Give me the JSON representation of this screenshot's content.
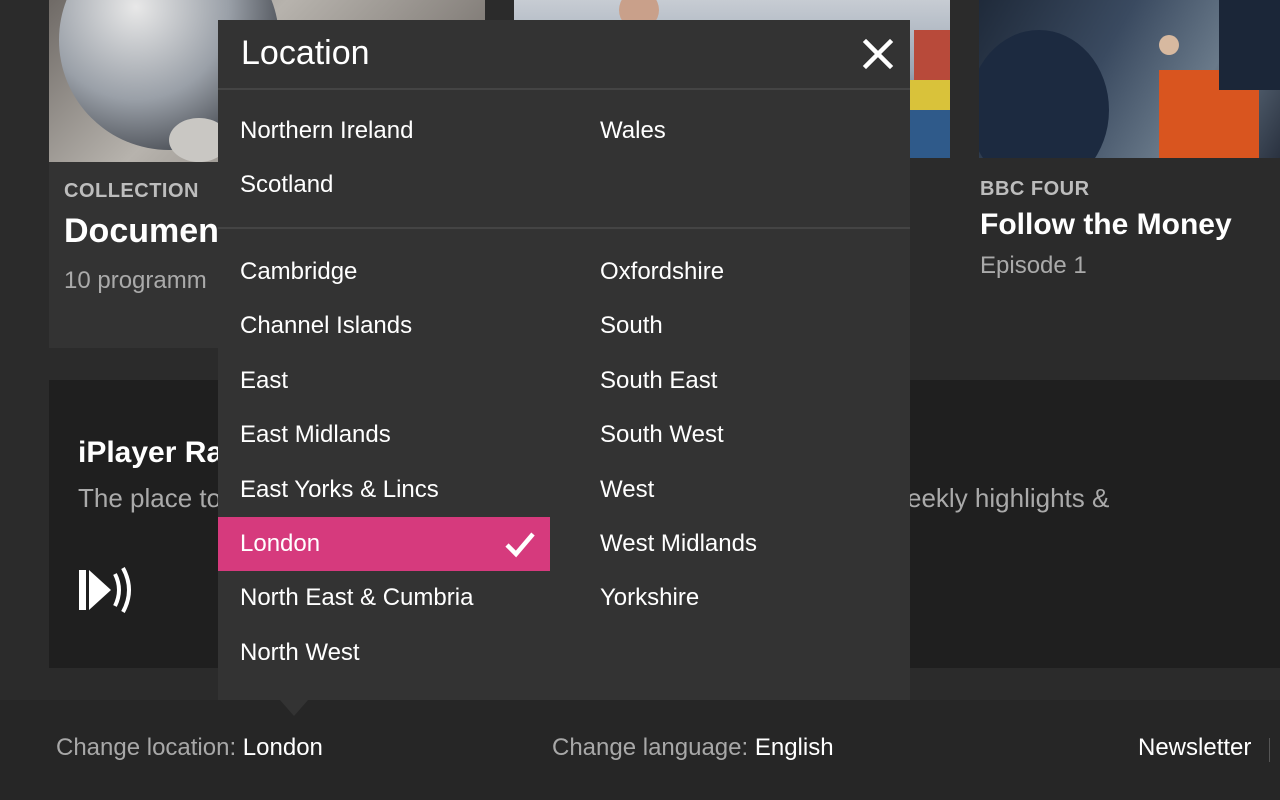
{
  "cards": [
    {
      "label": "",
      "title": "",
      "subtitle": ""
    },
    {
      "label": "COLLECTION",
      "title": "Documen",
      "subtitle": "10 programm"
    },
    {
      "label": "",
      "title": "",
      "subtitle": ""
    },
    {
      "label": "BBC FOUR",
      "title": "Follow the Money",
      "subtitle": "Episode 1"
    }
  ],
  "promo": {
    "title": "iPlayer Ra",
    "text_left": "The place to",
    "text_right": "eekly highlights &",
    "icon": "iplayer-radio-icon"
  },
  "modal": {
    "title": "Location",
    "close_icon": "close-icon",
    "nations": [
      "Northern Ireland",
      "Wales",
      "Scotland"
    ],
    "regions_left": [
      "Cambridge",
      "Channel Islands",
      "East",
      "East Midlands",
      "East Yorks & Lincs",
      "London",
      "North East & Cumbria",
      "North West"
    ],
    "regions_right": [
      "Oxfordshire",
      "South",
      "South East",
      "South West",
      "West",
      "West Midlands",
      "Yorkshire"
    ],
    "selected": "London",
    "selected_color": "#d63a7d"
  },
  "footer": {
    "location_label": "Change location: ",
    "location_value": "London",
    "language_label": "Change language: ",
    "language_value": "English",
    "newsletter": "Newsletter"
  }
}
